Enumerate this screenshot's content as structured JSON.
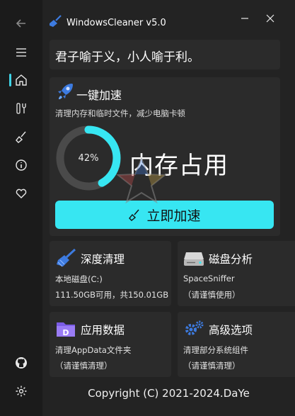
{
  "window": {
    "title": "WindowsCleaner v5.0"
  },
  "quote": "君子喻于义，小人喻于利。",
  "speed": {
    "title": "一键加速",
    "subtitle": "清理内存和临时文件，减少电脑卡顿",
    "memory_percent_label": "42%",
    "memory_percent": 42,
    "memory_label": "内存占用",
    "button_label": "立即加速"
  },
  "tiles": {
    "deep_clean": {
      "title": "深度清理",
      "line1": "本地磁盘(C:)",
      "line2": "111.50GB可用，共150.01GB"
    },
    "disk_analysis": {
      "title": "磁盘分析",
      "line1": "SpaceSniffer",
      "line2": "（请谨慎使用）"
    },
    "app_data": {
      "title": "应用数据",
      "line1": "清理AppData文件夹",
      "line2": "（请谨慎清理）"
    },
    "advanced": {
      "title": "高级选项",
      "line1": "清理部分系统组件",
      "line2": "（请谨慎清理）"
    }
  },
  "footer": "Copyright (C) 2021-2024.DaYe",
  "colors": {
    "accent": "#37e6f2",
    "ring_track": "#4a4a4a",
    "icon_blue": "#3d7be0",
    "icon_purple": "#7b5ce6"
  },
  "icons": [
    "back-arrow-icon",
    "menu-icon",
    "home-icon",
    "tools-icon",
    "broom-icon",
    "info-icon",
    "heart-icon",
    "github-icon",
    "settings-icon",
    "rocket-icon",
    "broom-icon",
    "disk-icon",
    "folder-icon",
    "gears-icon"
  ]
}
